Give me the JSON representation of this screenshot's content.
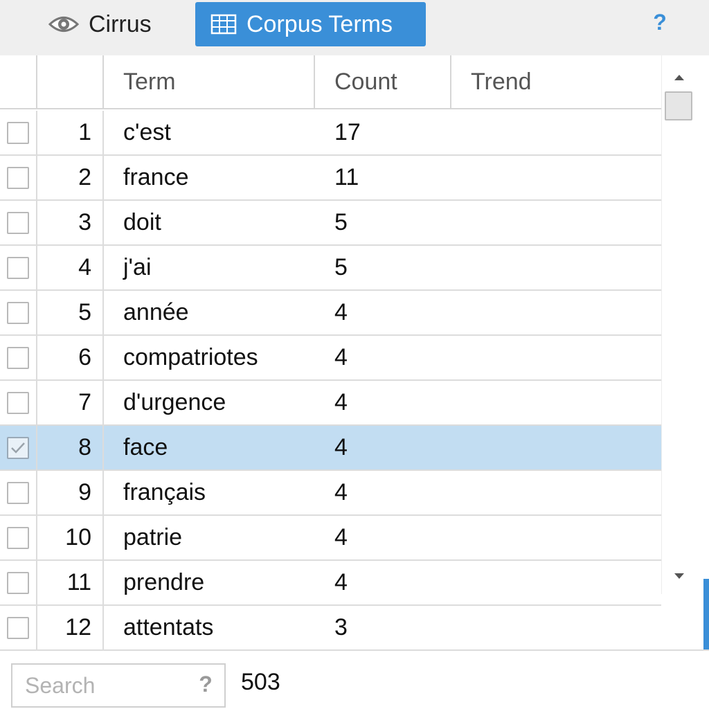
{
  "tabs": [
    {
      "label": "Cirrus",
      "icon": "eye-icon",
      "active": false
    },
    {
      "label": "Corpus Terms",
      "icon": "grid-icon",
      "active": true
    }
  ],
  "help_label": "?",
  "colors": {
    "accent": "#3a8fd8",
    "selected_row": "#c2ddf2"
  },
  "grid": {
    "columns": {
      "term": "Term",
      "count": "Count",
      "trend": "Trend"
    },
    "rows": [
      {
        "num": "1",
        "term": "c'est",
        "count": "17",
        "checked": false
      },
      {
        "num": "2",
        "term": "france",
        "count": "11",
        "checked": false
      },
      {
        "num": "3",
        "term": "doit",
        "count": "5",
        "checked": false
      },
      {
        "num": "4",
        "term": "j'ai",
        "count": "5",
        "checked": false
      },
      {
        "num": "5",
        "term": "année",
        "count": "4",
        "checked": false
      },
      {
        "num": "6",
        "term": "compatriotes",
        "count": "4",
        "checked": false
      },
      {
        "num": "7",
        "term": "d'urgence",
        "count": "4",
        "checked": false
      },
      {
        "num": "8",
        "term": "face",
        "count": "4",
        "checked": true
      },
      {
        "num": "9",
        "term": "français",
        "count": "4",
        "checked": false
      },
      {
        "num": "10",
        "term": "patrie",
        "count": "4",
        "checked": false
      },
      {
        "num": "11",
        "term": "prendre",
        "count": "4",
        "checked": false
      },
      {
        "num": "12",
        "term": "attentats",
        "count": "3",
        "checked": false
      }
    ]
  },
  "footer": {
    "search_placeholder": "Search",
    "search_help": "?",
    "total": "503"
  }
}
